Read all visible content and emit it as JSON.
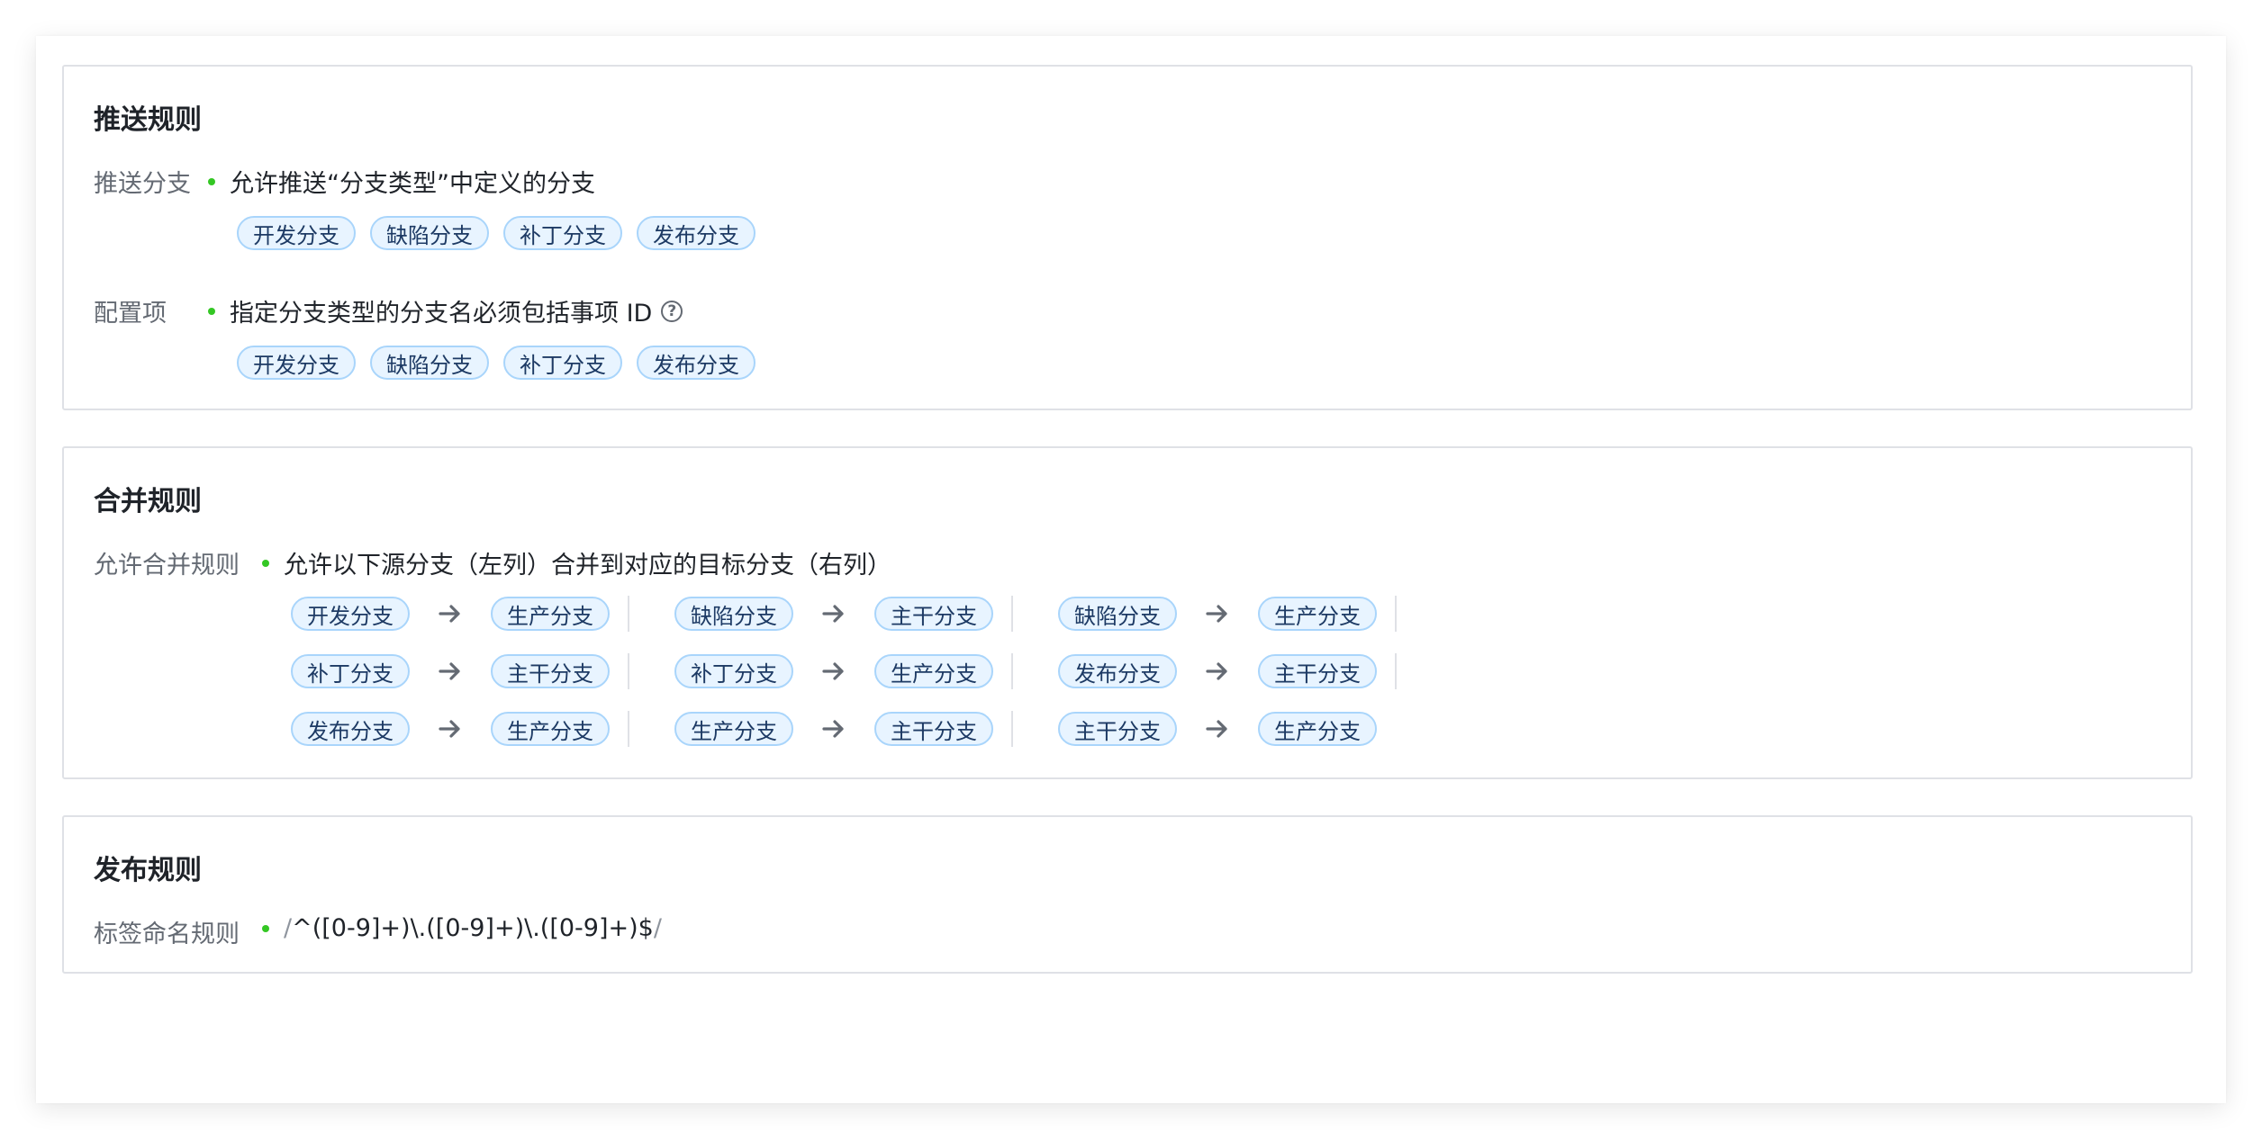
{
  "push_rules": {
    "title": "推送规则",
    "rows": [
      {
        "label": "推送分支",
        "text": "允许推送“分支类型”中定义的分支",
        "has_help": false,
        "tags": [
          "开发分支",
          "缺陷分支",
          "补丁分支",
          "发布分支"
        ]
      },
      {
        "label": "配置项",
        "text": "指定分支类型的分支名必须包括事项 ID",
        "has_help": true,
        "help_glyph": "?",
        "tags": [
          "开发分支",
          "缺陷分支",
          "补丁分支",
          "发布分支"
        ]
      }
    ]
  },
  "merge_rules": {
    "title": "合并规则",
    "label": "允许合并规则",
    "text": "允许以下源分支（左列）合并到对应的目标分支（右列）",
    "pairs": [
      [
        {
          "source": "开发分支",
          "target": "生产分支"
        },
        {
          "source": "缺陷分支",
          "target": "主干分支"
        },
        {
          "source": "缺陷分支",
          "target": "生产分支"
        }
      ],
      [
        {
          "source": "补丁分支",
          "target": "主干分支"
        },
        {
          "source": "补丁分支",
          "target": "生产分支"
        },
        {
          "source": "发布分支",
          "target": "主干分支"
        }
      ],
      [
        {
          "source": "发布分支",
          "target": "生产分支"
        },
        {
          "source": "生产分支",
          "target": "主干分支"
        },
        {
          "source": "主干分支",
          "target": "生产分支"
        }
      ]
    ]
  },
  "release_rules": {
    "title": "发布规则",
    "label": "标签命名规则",
    "regex_open": "/",
    "regex_body": "^([0-9]+)\\.([0-9]+)\\.([0-9]+)$",
    "regex_close": "/"
  },
  "colors": {
    "bullet": "#34c724",
    "tag_bg": "#e8f4ff",
    "tag_border": "#a9d5fb",
    "tag_text": "#1d3a64",
    "arrow": "#646a73",
    "border": "#dfe1e6"
  },
  "icons": {
    "arrow": "arrow-right-icon",
    "help": "question-circle-icon",
    "bullet": "bullet-dot-icon"
  }
}
